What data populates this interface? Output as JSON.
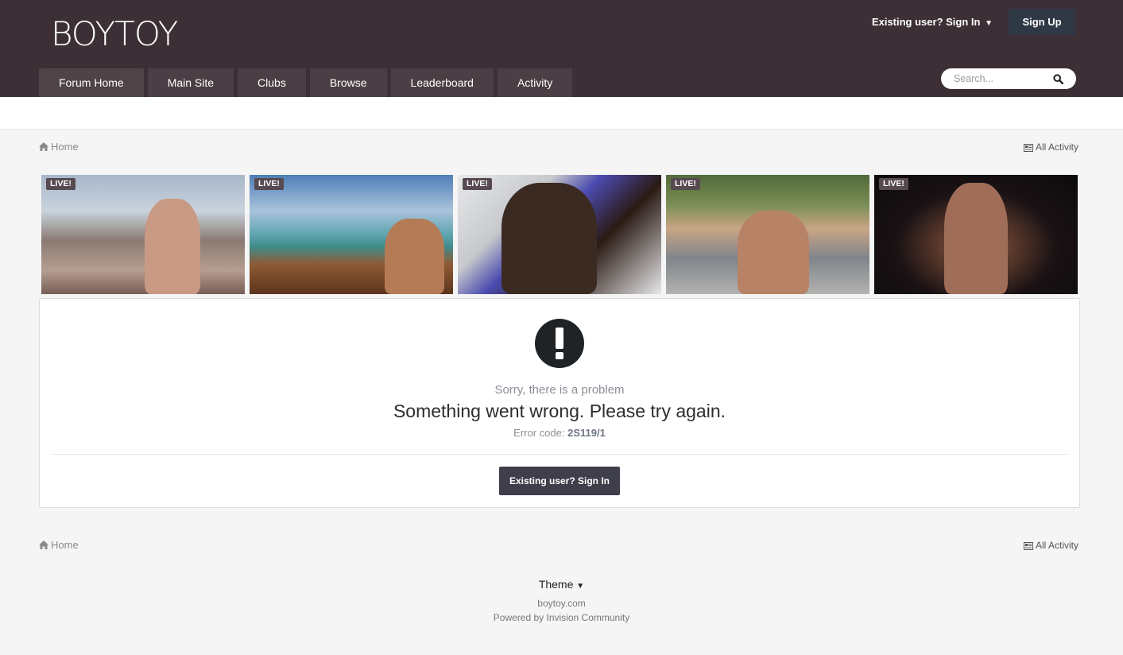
{
  "header": {
    "logo_text": "BOYTOY",
    "signin_label": "Existing user? Sign In",
    "signup_label": "Sign Up",
    "search_placeholder": "Search..."
  },
  "nav": {
    "items": [
      "Forum Home",
      "Main Site",
      "Clubs",
      "Browse",
      "Leaderboard",
      "Activity"
    ]
  },
  "breadcrumb": {
    "home_label": "Home",
    "all_activity_label": "All Activity"
  },
  "live_thumbs": {
    "badge_label": "LIVE!"
  },
  "error": {
    "subtitle": "Sorry, there is a problem",
    "message": "Something went wrong. Please try again.",
    "code_prefix": "Error code: ",
    "code": "2S119/1",
    "signin_button": "Existing user? Sign In"
  },
  "footer": {
    "theme_label": "Theme",
    "site": "boytoy.com",
    "powered_by": "Powered by Invision Community"
  },
  "colors": {
    "header_bg": "#3c2f36",
    "nav_item_bg": "#4b3f45",
    "signup_bg": "#2f3845",
    "button_bg": "#3e3f4a",
    "badge_bg": "#574a51"
  },
  "icons": {
    "home": "home-icon",
    "search": "search-icon",
    "activity": "newspaper-icon",
    "error": "exclamation-circle-icon",
    "caret": "caret-down-icon"
  }
}
